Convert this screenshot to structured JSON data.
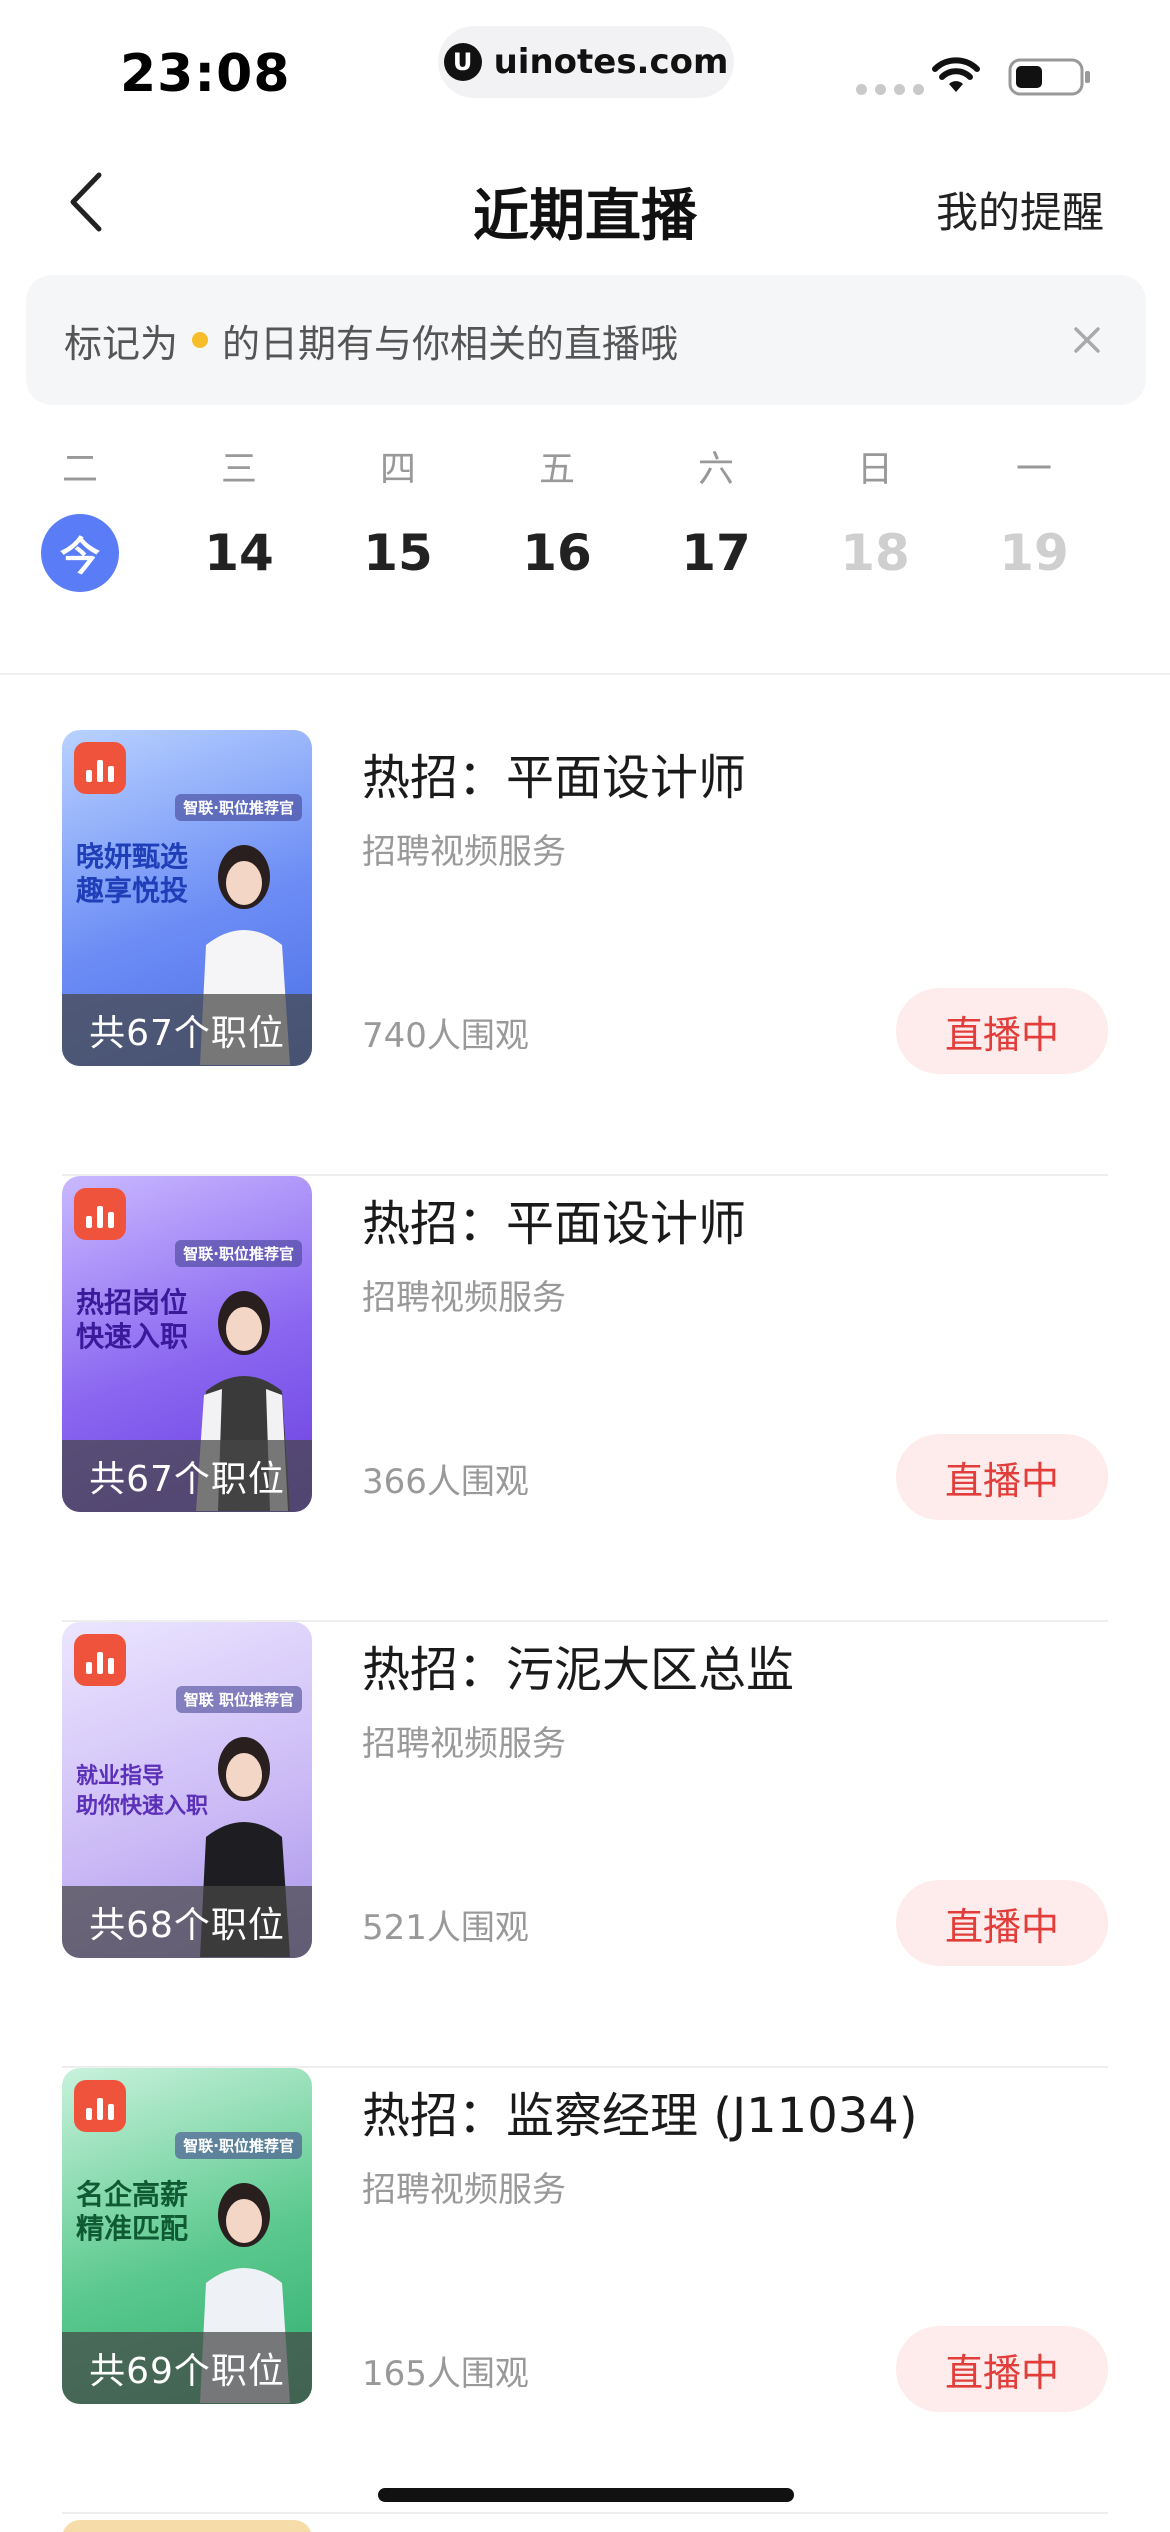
{
  "status_bar": {
    "time": "23:08",
    "url": "uinotes.com",
    "url_logo": "U"
  },
  "nav": {
    "title": "近期直播",
    "right_label": "我的提醒"
  },
  "notice": {
    "text_before": "标记为",
    "text_after": "的日期有与你相关的直播哦",
    "dot_color": "#f5bd2a"
  },
  "dates": [
    {
      "weekday": "二",
      "day": "今",
      "today": true
    },
    {
      "weekday": "三",
      "day": "14"
    },
    {
      "weekday": "四",
      "day": "15"
    },
    {
      "weekday": "五",
      "day": "16"
    },
    {
      "weekday": "六",
      "day": "17"
    },
    {
      "weekday": "日",
      "day": "18",
      "disabled": true
    },
    {
      "weekday": "一",
      "day": "19",
      "disabled": true
    }
  ],
  "colors": {
    "accent_blue": "#5b7cf7",
    "live_red": "#e23d3a",
    "live_bg": "#fdeceb"
  },
  "lives": [
    {
      "title": "热招：平面设计师",
      "subtitle": "招聘视频服务",
      "viewers": "740人围观",
      "status": "直播中",
      "thumb_footer": "共67个职位",
      "thumb_tag": "智联·职位推荐官",
      "thumb_slogan": [
        "晓妍甄选",
        "趣享悦投"
      ],
      "thumb_bg": "linear-gradient(160deg,#b8d2ff 0%,#6d8df5 55%,#4a6fe6 100%)",
      "slogan_color": "#1f3fb8"
    },
    {
      "title": "热招：平面设计师",
      "subtitle": "招聘视频服务",
      "viewers": "366人围观",
      "status": "直播中",
      "thumb_footer": "共67个职位",
      "thumb_tag": "智联·职位推荐官",
      "thumb_slogan": [
        "热招岗位",
        "快速入职"
      ],
      "thumb_bg": "linear-gradient(160deg,#c9b9ff 0%,#8a66f0 55%,#6a3fe0 100%)",
      "slogan_color": "#3a1a9a"
    },
    {
      "title": "热招：污泥大区总监",
      "subtitle": "招聘视频服务",
      "viewers": "521人围观",
      "status": "直播中",
      "thumb_footer": "共68个职位",
      "thumb_tag": "智联 职位推荐官",
      "thumb_slogan": [
        "就业指导",
        "助你快速入职"
      ],
      "thumb_bg": "linear-gradient(160deg,#ece6ff 0%,#c9b8f5 60%,#a793ea 100%)",
      "slogan_color": "#5b2fb8"
    },
    {
      "title": "热招：监察经理 (J11034)",
      "subtitle": "招聘视频服务",
      "viewers": "165人围观",
      "status": "直播中",
      "thumb_footer": "共69个职位",
      "thumb_tag": "智联·职位推荐官",
      "thumb_slogan": [
        "名企高薪",
        "精准匹配"
      ],
      "thumb_bg": "linear-gradient(160deg,#c8f2dc 0%,#5cc98f 55%,#2fae6e 100%)",
      "slogan_color": "#0f5a33"
    }
  ]
}
